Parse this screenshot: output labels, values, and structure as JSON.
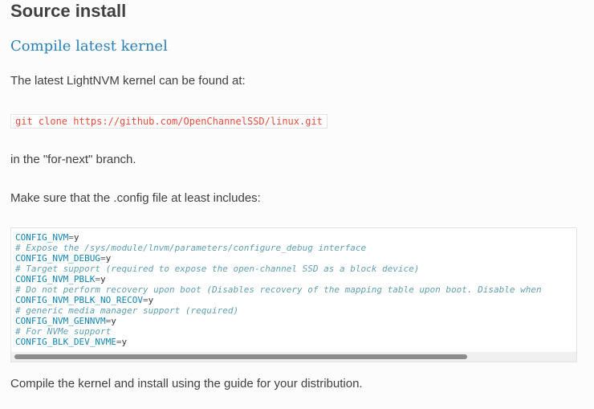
{
  "heading": "Source install",
  "subheading": "Compile latest kernel",
  "intro": "The latest LightNVM kernel can be found at:",
  "git_command": "git clone https://github.com/OpenChannelSSD/linux.git",
  "branch_note": "in the \"for-next\" branch.",
  "config_note": "Make sure that the .config file at least includes:",
  "code_block": {
    "lines": [
      {
        "type": "assign",
        "key": "CONFIG_NVM",
        "op": "=",
        "val": "y"
      },
      {
        "type": "comment",
        "text": "# Expose the /sys/module/lnvm/parameters/configure_debug interface"
      },
      {
        "type": "assign",
        "key": "CONFIG_NVM_DEBUG",
        "op": "=",
        "val": "y"
      },
      {
        "type": "comment",
        "text": "# Target support (required to expose the open-channel SSD as a block device)"
      },
      {
        "type": "assign",
        "key": "CONFIG_NVM_PBLK",
        "op": "=",
        "val": "y"
      },
      {
        "type": "comment",
        "text": "# Do not perform recovery upon boot (Disables recovery of the mapping table upon boot. Disable when"
      },
      {
        "type": "assign",
        "key": "CONFIG_NVM_PBLK_NO_RECOV",
        "op": "=",
        "val": "y"
      },
      {
        "type": "comment",
        "text": "# generic media manager support (required)"
      },
      {
        "type": "assign",
        "key": "CONFIG_NVM_GENNVM",
        "op": "=",
        "val": "y"
      },
      {
        "type": "comment",
        "text": "# For NVMe support"
      },
      {
        "type": "assign",
        "key": "CONFIG_BLK_DEV_NVME",
        "op": "=",
        "val": "y"
      }
    ],
    "scroll_position": 0
  },
  "closing": "Compile the kernel and install using the guide for your distribution."
}
